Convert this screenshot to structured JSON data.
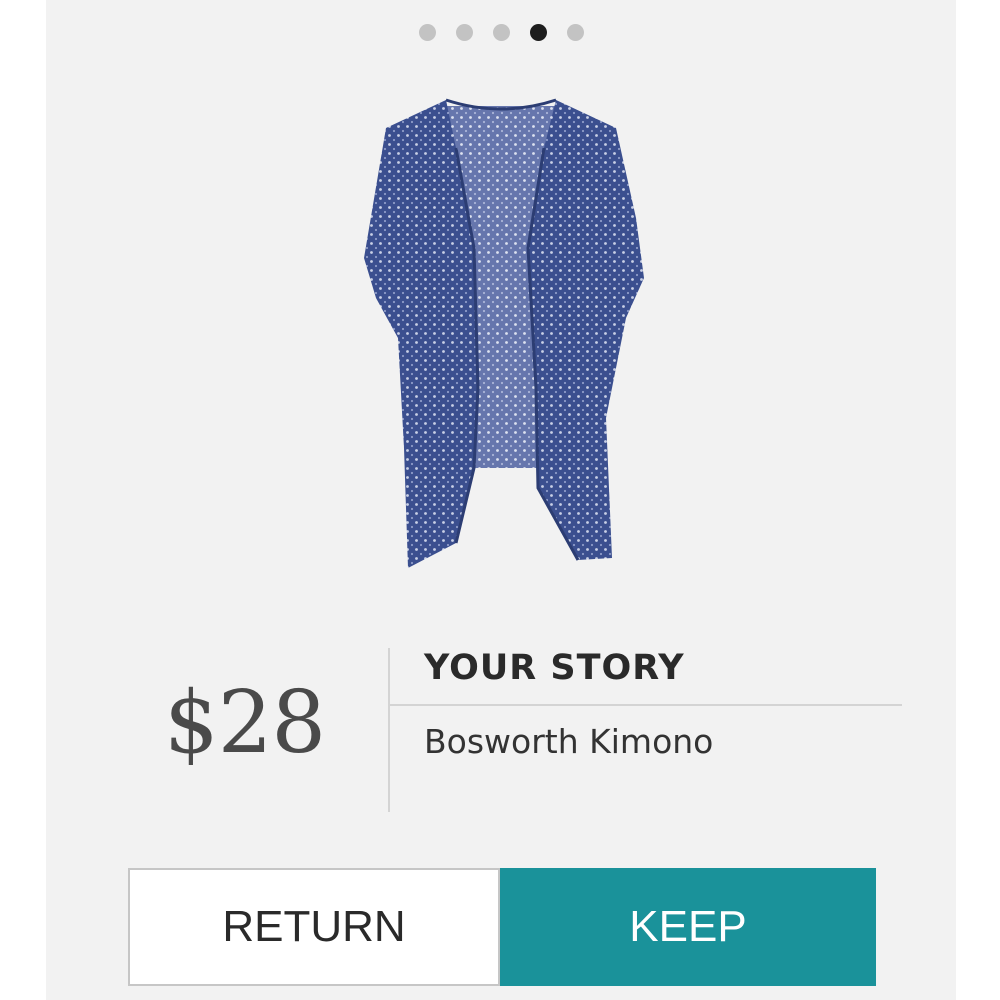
{
  "carousel": {
    "dot_count": 5,
    "active_index": 3
  },
  "product": {
    "price": "$28",
    "brand": "YOUR STORY",
    "name": "Bosworth Kimono"
  },
  "actions": {
    "return_label": "RETURN",
    "keep_label": "KEEP"
  },
  "colors": {
    "card_background": "#f2f2f2",
    "keep_button": "#1a929a",
    "garment": "#3b4f8f"
  }
}
